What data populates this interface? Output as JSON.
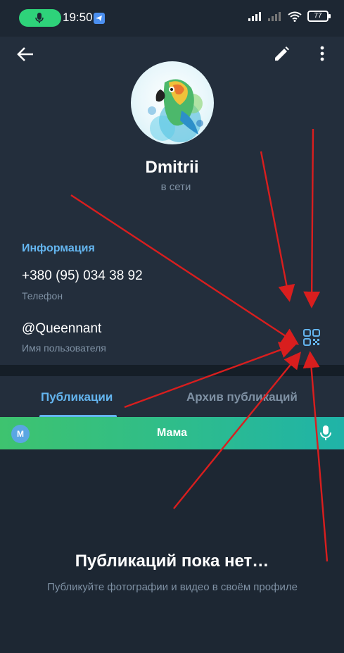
{
  "status_bar": {
    "time": "19:50",
    "battery": "77",
    "icons": [
      "mic-icon",
      "telegram-icon",
      "signal-icon",
      "signal-off-icon",
      "wifi-icon",
      "battery-icon"
    ]
  },
  "header": {
    "back_icon": "arrow-left-icon",
    "edit_icon": "pencil-icon",
    "more_icon": "more-vert-icon",
    "name": "Dmitrii",
    "status": "в сети"
  },
  "info": {
    "title": "Информация",
    "phone": "+380 (95) 034 38 92",
    "phone_label": "Телефон",
    "username": "@Queennant",
    "username_label": "Имя пользователя",
    "qr_icon": "qr-code-icon"
  },
  "tabs": [
    {
      "label": "Публикации",
      "active": true
    },
    {
      "label": "Архив публикаций",
      "active": false
    }
  ],
  "call_bar": {
    "avatar_letter": "M",
    "name": "Мама",
    "mic_icon": "mic-icon"
  },
  "empty_state": {
    "title": "Публикаций пока нет…",
    "subtitle": "Публикуйте фотографии и видео в своём профиле"
  },
  "colors": {
    "background": "#1d2733",
    "panel": "#232e3c",
    "accent": "#64b5ef",
    "muted": "#7f91a4",
    "call_green": "#3ec36f",
    "annotation_red": "#d91e1e"
  }
}
